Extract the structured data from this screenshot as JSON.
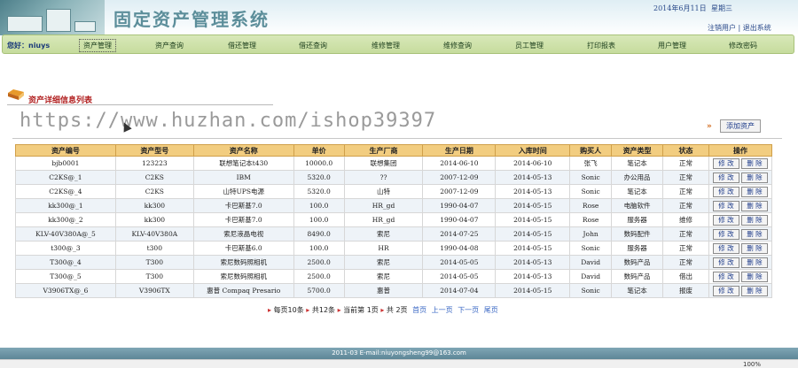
{
  "header": {
    "title": "固定资产管理系统",
    "date": "2014年6月11日",
    "weekday": "星期三",
    "logout_user": "注销用户",
    "exit_system": "退出系统",
    "separator": "|"
  },
  "nav": {
    "greeting": "您好：niuys",
    "items": [
      "资产管理",
      "资产查询",
      "借还管理",
      "借还查询",
      "维修管理",
      "维修查询",
      "员工管理",
      "打印报表",
      "用户管理",
      "修改密码"
    ]
  },
  "section": {
    "title": "资产详细信息列表"
  },
  "watermark": "https://www.huzhan.com/ishop39397",
  "add_button": "添加资产",
  "table": {
    "headers": [
      "资产编号",
      "资产型号",
      "资产名称",
      "单价",
      "生产厂商",
      "生产日期",
      "入库时间",
      "购买人",
      "资产类型",
      "状态",
      "操作"
    ],
    "edit_label": "修 改",
    "delete_label": "删 除",
    "rows": [
      [
        "bjb0001",
        "123223",
        "联想笔记本t430",
        "10000.0",
        "联想集团",
        "2014-06-10",
        "2014-06-10",
        "张飞",
        "笔记本",
        "正常"
      ],
      [
        "C2KS@_1",
        "C2KS",
        "IBM",
        "5320.0",
        "??",
        "2007-12-09",
        "2014-05-13",
        "Sonic",
        "办公用品",
        "正常"
      ],
      [
        "C2KS@_4",
        "C2KS",
        "山特UPS电源",
        "5320.0",
        "山特",
        "2007-12-09",
        "2014-05-13",
        "Sonic",
        "笔记本",
        "正常"
      ],
      [
        "kk300@_1",
        "kk300",
        "卡巴斯基7.0",
        "100.0",
        "HR_gd",
        "1990-04-07",
        "2014-05-15",
        "Rose",
        "电脑软件",
        "正常"
      ],
      [
        "kk300@_2",
        "kk300",
        "卡巴斯基7.0",
        "100.0",
        "HR_gd",
        "1990-04-07",
        "2014-05-15",
        "Rose",
        "服务器",
        "维修"
      ],
      [
        "KLV-40V380A@_5",
        "KLV-40V380A",
        "索尼液晶电视",
        "8490.0",
        "索尼",
        "2014-07-25",
        "2014-05-15",
        "John",
        "数码配件",
        "正常"
      ],
      [
        "t300@_3",
        "t300",
        "卡巴斯基6.0",
        "100.0",
        "HR",
        "1990-04-08",
        "2014-05-15",
        "Sonic",
        "服务器",
        "正常"
      ],
      [
        "T300@_4",
        "T300",
        "索尼数码照相机",
        "2500.0",
        "索尼",
        "2014-05-05",
        "2014-05-13",
        "David",
        "数码产品",
        "正常"
      ],
      [
        "T300@_5",
        "T300",
        "索尼数码照相机",
        "2500.0",
        "索尼",
        "2014-05-05",
        "2014-05-13",
        "David",
        "数码产品",
        "借出"
      ],
      [
        "V3906TX@_6",
        "V3906TX",
        "惠普 Compaq Presario",
        "5700.0",
        "惠普",
        "2014-07-04",
        "2014-05-15",
        "Sonic",
        "笔记本",
        "报废"
      ]
    ]
  },
  "pager": {
    "per_page": "每页10条",
    "total": "共12条",
    "current": "当前第 1页",
    "pages": "共 2页",
    "first": "首页",
    "prev": "上一页",
    "next": "下一页",
    "last": "尾页"
  },
  "footer": {
    "text": "2011-03 E-mail:niuyongsheng99@163.com"
  },
  "status": {
    "zoom": "100%"
  }
}
